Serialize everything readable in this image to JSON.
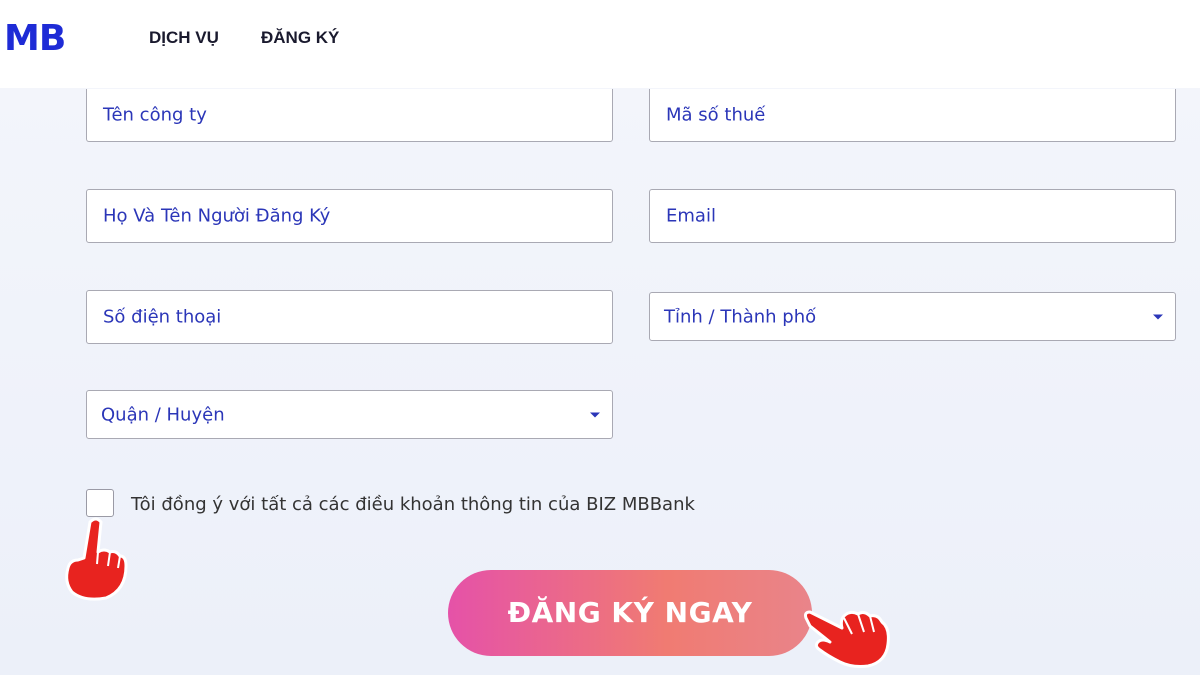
{
  "header": {
    "logo": "MB",
    "nav": [
      "DỊCH VỤ",
      "ĐĂNG KÝ"
    ]
  },
  "form": {
    "company_name": "Tên công ty",
    "tax_code": "Mã số thuế",
    "registrant_name": "Họ Và Tên Người Đăng Ký",
    "email": "Email",
    "phone": "Số điện thoại",
    "province_select": "Tỉnh / Thành phố",
    "district_select": "Quận / Huyện",
    "consent_text": "Tôi đồng ý với tất cả các điều khoản thông tin của BIZ MBBank",
    "submit_label": "ĐĂNG KÝ NGAY"
  },
  "colors": {
    "brand": "#1e2bd6",
    "placeholder": "#2b36b8",
    "cta_start": "#e552a8",
    "cta_end": "#f07b72",
    "pointer_hand": "#e8231f"
  },
  "icons": [
    "pointing-hand-icon",
    "chevron-down-icon"
  ]
}
